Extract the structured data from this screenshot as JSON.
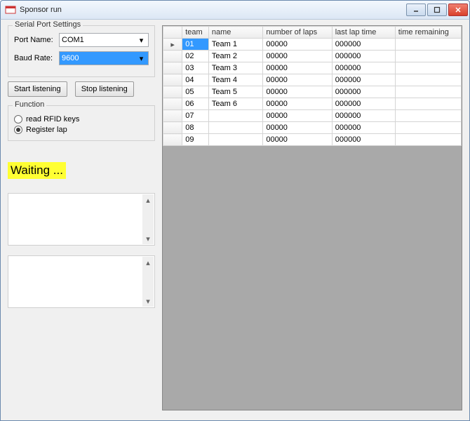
{
  "window": {
    "title": "Sponsor run"
  },
  "serial": {
    "legend": "Serial Port Settings",
    "port_label": "Port Name:",
    "port_value": "COM1",
    "baud_label": "Baud Rate:",
    "baud_value": "9600"
  },
  "buttons": {
    "start": "Start listening",
    "stop": "Stop listening"
  },
  "function": {
    "legend": "Function",
    "opt_read": "read RFID keys",
    "opt_register": "Register lap",
    "selected": "register"
  },
  "status_text": "Waiting ...",
  "grid": {
    "headers": {
      "team": "team",
      "name": "name",
      "laps": "number of laps",
      "last": "last lap time",
      "rem": "time remaining"
    },
    "rows": [
      {
        "team": "01",
        "name": "Team 1",
        "laps": "00000",
        "last": "000000",
        "rem": ""
      },
      {
        "team": "02",
        "name": "Team 2",
        "laps": "00000",
        "last": "000000",
        "rem": ""
      },
      {
        "team": "03",
        "name": "Team 3",
        "laps": "00000",
        "last": "000000",
        "rem": ""
      },
      {
        "team": "04",
        "name": "Team 4",
        "laps": "00000",
        "last": "000000",
        "rem": ""
      },
      {
        "team": "05",
        "name": "Team 5",
        "laps": "00000",
        "last": "000000",
        "rem": ""
      },
      {
        "team": "06",
        "name": "Team 6",
        "laps": "00000",
        "last": "000000",
        "rem": ""
      },
      {
        "team": "07",
        "name": "",
        "laps": "00000",
        "last": "000000",
        "rem": ""
      },
      {
        "team": "08",
        "name": "",
        "laps": "00000",
        "last": "000000",
        "rem": ""
      },
      {
        "team": "09",
        "name": "",
        "laps": "00000",
        "last": "000000",
        "rem": ""
      }
    ],
    "selected_row": 0
  }
}
